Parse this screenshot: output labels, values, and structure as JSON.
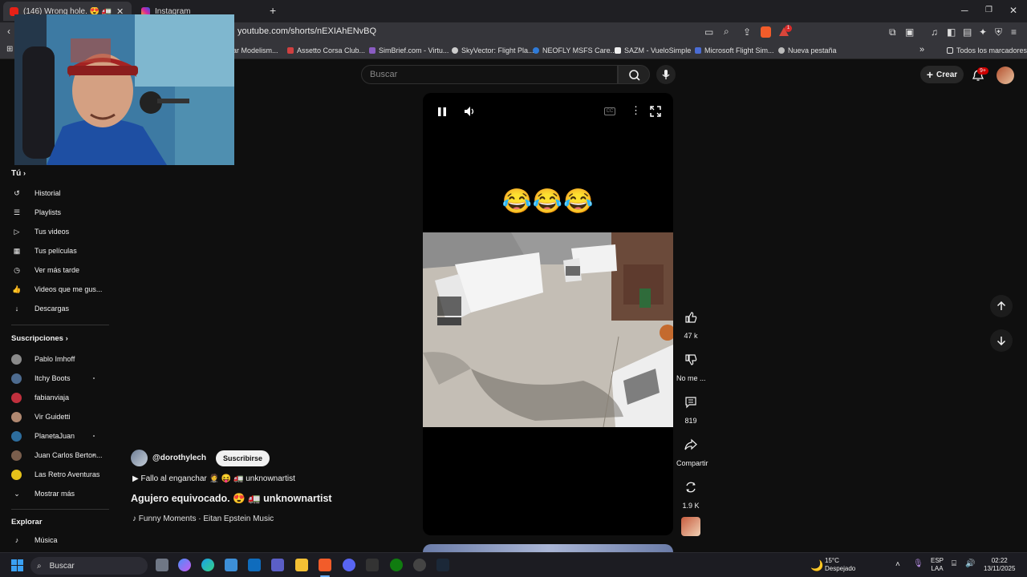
{
  "browser": {
    "tabs": [
      {
        "label": "(146) Wrong hole. 😍 🚛 un",
        "active": true
      },
      {
        "label": "Instagram",
        "active": false
      }
    ],
    "new_tab": "+",
    "url": "youtube.com/shorts/nEXIAhENvBQ",
    "bookmarks": [
      "ar Modelism...",
      "Assetto Corsa Club...",
      "SimBrief.com - Virtu...",
      "SkyVector: Flight Pla...",
      "NEOFLY MSFS Care...",
      "SAZM - VueloSimple",
      "Microsoft Flight Sim...",
      "Nueva pestaña"
    ],
    "all_bookmarks": "Todos los marcadores",
    "notification_badge": "1"
  },
  "youtube": {
    "search_placeholder": "Buscar",
    "create_label": "Crear",
    "notifications_badge": "9+"
  },
  "sidebar": {
    "you_heading": "Tú",
    "you_items": [
      {
        "label": "Historial",
        "icon": "history-icon"
      },
      {
        "label": "Playlists",
        "icon": "playlist-icon"
      },
      {
        "label": "Tus videos",
        "icon": "video-icon"
      },
      {
        "label": "Tus películas",
        "icon": "movie-icon"
      },
      {
        "label": "Ver más tarde",
        "icon": "clock-icon"
      },
      {
        "label": "Videos que me gus...",
        "icon": "thumbs-up-icon"
      },
      {
        "label": "Descargas",
        "icon": "download-icon"
      }
    ],
    "subs_heading": "Suscripciones",
    "subscriptions": [
      {
        "label": "Pablo Imhoff",
        "color": "#8a8a8a",
        "dot": false
      },
      {
        "label": "Itchy Boots",
        "color": "#4d6b8f",
        "dot": true
      },
      {
        "label": "fabianviaja",
        "color": "#c0303d",
        "dot": false
      },
      {
        "label": "Vir Guidetti",
        "color": "#b08870",
        "dot": false
      },
      {
        "label": "PlanetaJuan",
        "color": "#2d6d9d",
        "dot": true
      },
      {
        "label": "Juan Carlos Berton...",
        "color": "#7a5e4d",
        "dot": false
      },
      {
        "label": "Las Retro Aventuras",
        "color": "#e5c21a",
        "dot": false
      }
    ],
    "show_more": "Mostrar más",
    "explore_heading": "Explorar",
    "explore_items": [
      {
        "label": "Música",
        "icon": "music-icon"
      }
    ]
  },
  "video": {
    "emojis": "😂😂😂",
    "channel": "@dorothylech",
    "subscribe": "Suscribirse",
    "music_line": "▶ Fallo al enganchar 🤵 😝 🚛 unknownartist",
    "title": "Agujero equivocado. 😍 🚛 unknownartist",
    "sound": "♪ Funny Moments · Eitan Epstein Music"
  },
  "actions": {
    "likes": "47 k",
    "dislike": "No me ...",
    "comments": "819",
    "share": "Compartir",
    "remix": "1.9 K"
  },
  "taskbar": {
    "search": "Buscar",
    "weather_temp": "15°C",
    "weather_desc": "Despejado",
    "lang_1": "ESP",
    "lang_2": "LAA",
    "time": "02:22",
    "date": "13/11/2025"
  }
}
